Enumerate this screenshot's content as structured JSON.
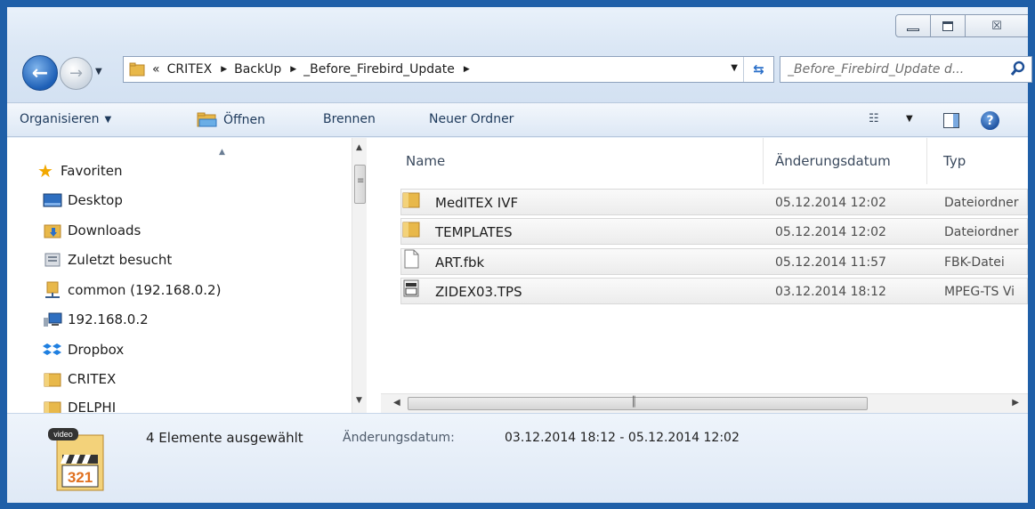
{
  "window": {
    "controls": {
      "minimize": "minimize-icon",
      "maximize": "maximize-icon",
      "close": "close-icon",
      "close_glyph": "☒"
    }
  },
  "navigation": {
    "address": {
      "overflow": "«",
      "crumbs": [
        "CRITEX",
        "BackUp",
        "_Before_Firebird_Update"
      ]
    },
    "search": {
      "placeholder": "_Before_Firebird_Update d..."
    }
  },
  "toolbar": {
    "organize": "Organisieren",
    "open": "Öffnen",
    "burn": "Brennen",
    "new_folder": "Neuer Ordner"
  },
  "sidebar": {
    "favorites": "Favoriten",
    "items": [
      {
        "label": "Desktop",
        "icon": "desktop-icon"
      },
      {
        "label": "Downloads",
        "icon": "downloads-folder-icon"
      },
      {
        "label": "Zuletzt besucht",
        "icon": "recent-places-icon"
      },
      {
        "label": "common (192.168.0.2)",
        "icon": "network-share-icon"
      },
      {
        "label": "192.168.0.2",
        "icon": "network-computer-icon"
      },
      {
        "label": "Dropbox",
        "icon": "dropbox-icon"
      },
      {
        "label": "CRITEX",
        "icon": "folder-icon"
      },
      {
        "label": "DELPHI",
        "icon": "folder-icon"
      }
    ]
  },
  "filelist": {
    "columns": {
      "name": "Name",
      "date": "Änderungsdatum",
      "type": "Typ"
    },
    "rows": [
      {
        "name": "MedITEX IVF",
        "date": "05.12.2014 12:02",
        "type": "Dateiordner",
        "icon": "folder-icon"
      },
      {
        "name": "TEMPLATES",
        "date": "05.12.2014 12:02",
        "type": "Dateiordner",
        "icon": "folder-icon"
      },
      {
        "name": "ART.fbk",
        "date": "05.12.2014 11:57",
        "type": "FBK-Datei",
        "icon": "file-icon"
      },
      {
        "name": "ZIDEX03.TPS",
        "date": "03.12.2014 18:12",
        "type": "MPEG-TS Vi",
        "icon": "video-file-icon"
      }
    ]
  },
  "details": {
    "count": "4 Elemente ausgewählt",
    "date_label": "Änderungsdatum:",
    "date_value": "03.12.2014 18:12 - 05.12.2014 12:02",
    "thumb_badge": "video",
    "thumb_number": "321"
  },
  "colors": {
    "frame": "#1f5fa8",
    "folder": "#e8b84a",
    "selection": "#ececec"
  }
}
